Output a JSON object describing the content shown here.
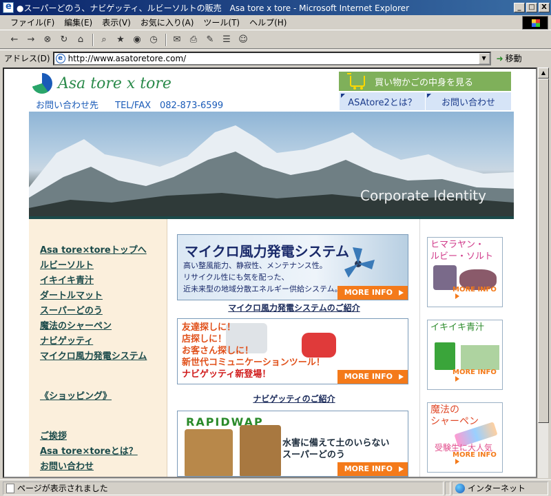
{
  "window": {
    "title": "●スーパーどのう、ナビゲッティ、ルビーソルトの販売　Asa tore x tore - Microsoft Internet Explorer",
    "minimize": "_",
    "maximize": "□",
    "close": "X"
  },
  "menu": {
    "items": [
      "ファイル(F)",
      "編集(E)",
      "表示(V)",
      "お気に入り(A)",
      "ツール(T)",
      "ヘルプ(H)"
    ]
  },
  "toolbar": {
    "buttons": [
      "back-icon",
      "forward-icon",
      "stop-icon",
      "refresh-icon",
      "home-icon",
      "search-icon",
      "favorites-icon",
      "media-icon",
      "history-icon",
      "mail-icon",
      "print-icon",
      "edit-icon",
      "discuss-icon",
      "messenger-icon"
    ]
  },
  "address": {
    "label": "アドレス(D)",
    "url": "http://www.asatoretore.com/",
    "go_label": "移動"
  },
  "status": {
    "text": "ページが表示されました",
    "zone": "インターネット"
  },
  "site": {
    "logo": "Asa tore x tore",
    "contact_label": "お問い合わせ先",
    "contact_phone": "TEL/FAX　082-873-6599",
    "cart_label": "買い物かごの中身を見る",
    "nav_about": "ASAtore2とは？",
    "nav_contact": "お問い合わせ",
    "banner_text": "Corporate Identity"
  },
  "sidebar": {
    "links1": [
      "Asa tore×toreトップへ",
      "ルビーソルト",
      "イキイキ青汁",
      "ダートルマット",
      "スーパーどのう",
      "魔法のシャーペン",
      "ナビゲッティ",
      "マイクロ風力発電システム"
    ],
    "shopping": "《ショッピング》",
    "links2": [
      "ご挨拶",
      "Asa tore×toreとは？",
      "お問い合わせ"
    ]
  },
  "promos": {
    "more_label": "MORE INFO",
    "p1": {
      "title": "マイクロ風力発電システム",
      "line1": "高い整風能力、静寂性、メンテナンス性。",
      "line2": "リサイクル性にも気を配った、",
      "line3": "近未来型の地域分散エネルギー供給システム。",
      "caption": "マイクロ風力発電システムのご紹介"
    },
    "p2": {
      "line1": "友達探しに！",
      "line2": "店探しに！",
      "line3": "お客さん探しに！",
      "line4": "新世代コミュニケーションツール！",
      "line5": "ナビゲッティ新登場！",
      "caption": "ナビゲッティのご紹介"
    },
    "p3": {
      "brand": "RAPIDWAP",
      "line1": "水害に備えて土のいらない",
      "line2": "スーパーどのう"
    }
  },
  "thumbs": {
    "more_label": "MORE INFO",
    "t1": {
      "line1": "ヒマラヤン・",
      "line2": "ルビー・ソルト"
    },
    "t2": {
      "line1": "イキイキ青汁"
    },
    "t3": {
      "line1": "魔法の",
      "line2": "シャーペン",
      "sub": "受験生に大人気"
    }
  }
}
